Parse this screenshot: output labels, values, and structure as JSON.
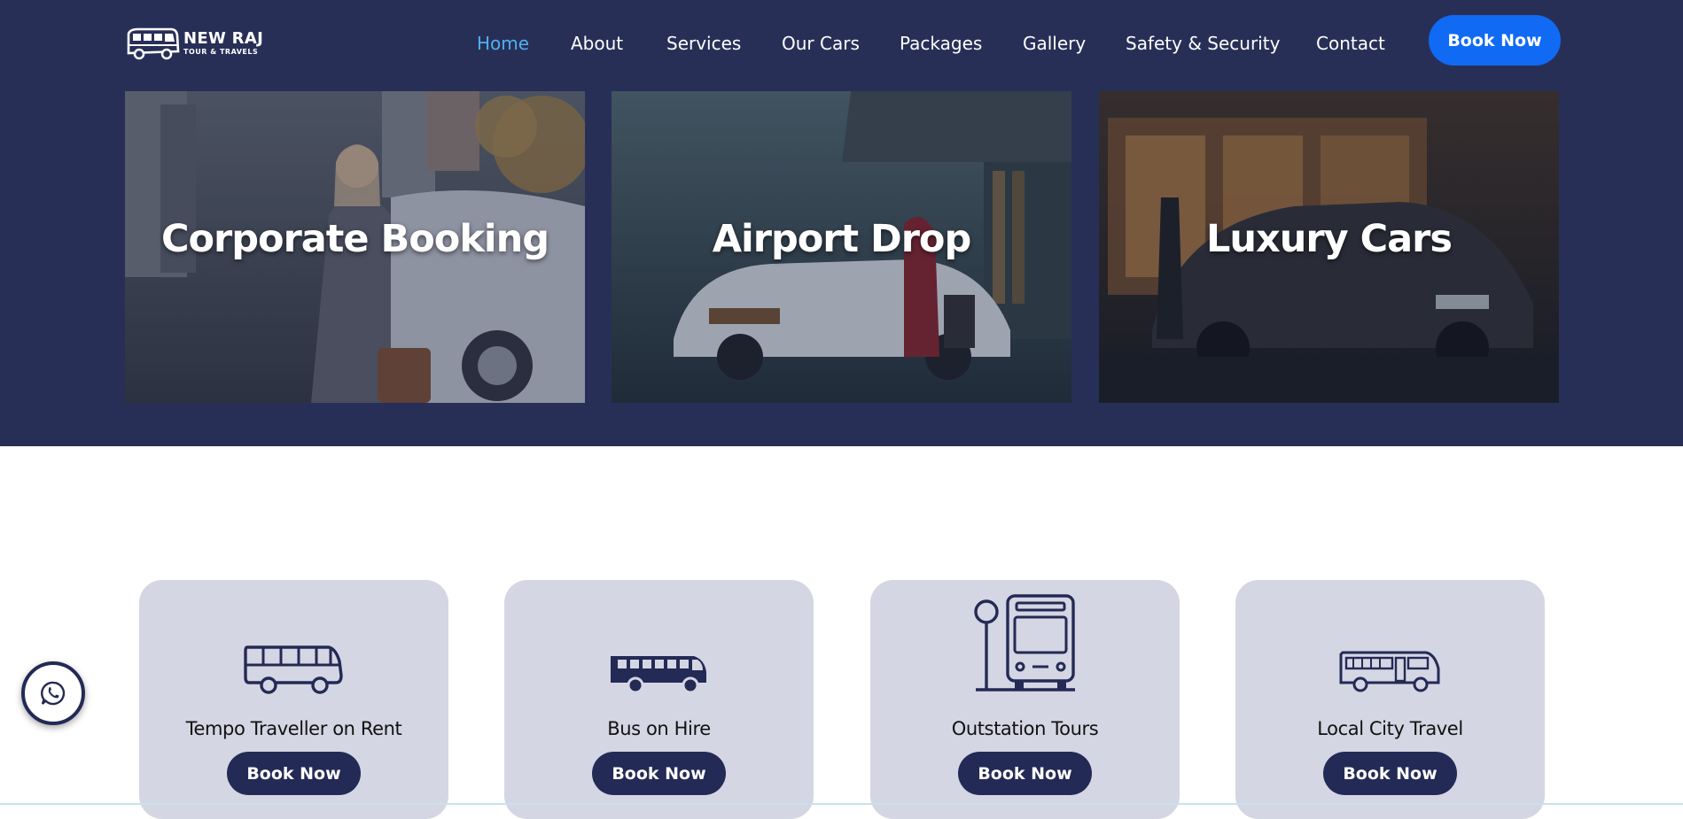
{
  "brand": {
    "name": "NEW RAJ",
    "tagline": "TOUR & TRAVELS",
    "logo_icon": "bus-icon"
  },
  "nav": {
    "items": [
      {
        "label": "Home",
        "active": true
      },
      {
        "label": "About"
      },
      {
        "label": "Services"
      },
      {
        "label": "Our Cars"
      },
      {
        "label": "Packages"
      },
      {
        "label": "Gallery"
      },
      {
        "label": "Safety & Security"
      },
      {
        "label": "Contact"
      }
    ],
    "cta": "Book Now"
  },
  "hero_cards": [
    {
      "title": "Corporate Booking"
    },
    {
      "title": "Airport Drop"
    },
    {
      "title": "Luxury Cars"
    }
  ],
  "services": [
    {
      "title": "Tempo Traveller on Rent",
      "button": "Book Now",
      "icon": "tempo-traveller-icon"
    },
    {
      "title": "Bus on Hire",
      "button": "Book Now",
      "icon": "bus-icon"
    },
    {
      "title": "Outstation Tours",
      "button": "Book Now",
      "icon": "bus-stop-icon"
    },
    {
      "title": "Local City Travel",
      "button": "Book Now",
      "icon": "city-bus-icon"
    }
  ],
  "floating": {
    "icon": "whatsapp-icon"
  },
  "colors": {
    "hero_bg": "#282f57",
    "nav_active": "#4fb0f0",
    "cta_blue": "#106af4",
    "card_bg": "#d5d6e3",
    "button_navy": "#232a55"
  }
}
